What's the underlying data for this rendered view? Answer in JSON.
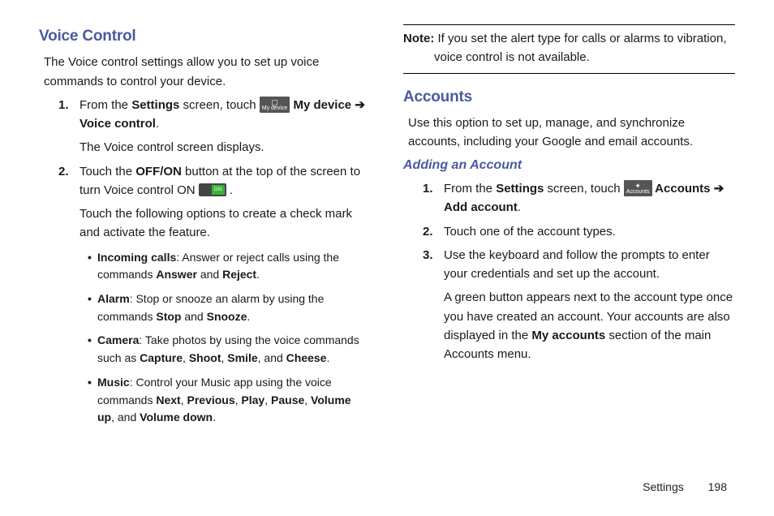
{
  "left": {
    "h_voice": "Voice Control",
    "voice_intro": "The Voice control settings allow you to set up voice commands to control your device.",
    "step1_a": "From the ",
    "step1_b": "Settings",
    "step1_c": " screen, touch ",
    "step1_icon": "My device",
    "step1_d": " My device ",
    "step1_arrow": "➔",
    "step1_e": "Voice control",
    "step1_dot": ".",
    "step1_extra": "The Voice control screen displays.",
    "step2_a": "Touch the ",
    "step2_b": "OFF/ON",
    "step2_c": " button at the top of the screen to turn Voice control ON ",
    "step2_toggle": "ON",
    "step2_d": " .",
    "step2_extra": "Touch the following options to create a check mark and activate the feature.",
    "feat_calls_a": "Incoming calls",
    "feat_calls_b": ": Answer or reject calls using the commands ",
    "feat_calls_c": "Answer",
    "feat_calls_d": " and ",
    "feat_calls_e": "Reject",
    "feat_calls_f": ".",
    "feat_alarm_a": "Alarm",
    "feat_alarm_b": ": Stop or snooze an alarm by using the commands ",
    "feat_alarm_c": "Stop",
    "feat_alarm_d": " and ",
    "feat_alarm_e": "Snooze",
    "feat_alarm_f": ".",
    "feat_cam_a": "Camera",
    "feat_cam_b": ": Take photos by using the voice commands such as ",
    "feat_cam_c": "Capture",
    "feat_cam_d": ", ",
    "feat_cam_e": "Shoot",
    "feat_cam_f": ", ",
    "feat_cam_g": "Smile",
    "feat_cam_h": ", and ",
    "feat_cam_i": "Cheese",
    "feat_cam_j": ".",
    "feat_music_a": "Music",
    "feat_music_b": ": Control your Music app using the voice commands ",
    "feat_music_c": "Next",
    "feat_music_d": ", ",
    "feat_music_e": "Previous",
    "feat_music_f": ", ",
    "feat_music_g": "Play",
    "feat_music_h": ", ",
    "feat_music_i": "Pause",
    "feat_music_j": ", ",
    "feat_music_k": "Volume up",
    "feat_music_l": ", and ",
    "feat_music_m": "Volume down",
    "feat_music_n": "."
  },
  "right": {
    "note_a": "Note:",
    "note_b": " If you set the alert type for calls or alarms to vibration, ",
    "note_c": "voice control is not available.",
    "h_accounts": "Accounts",
    "acc_intro": "Use this option to set up, manage, and synchronize accounts, including your Google and email accounts.",
    "h_add": "Adding an Account",
    "s1_a": "From the ",
    "s1_b": "Settings",
    "s1_c": " screen, touch ",
    "s1_icon": "Accounts",
    "s1_d": " Accounts ",
    "s1_arrow": "➔",
    "s1_e": " ",
    "s1_f": "Add account",
    "s1_g": ".",
    "s2": "Touch one of the account types.",
    "s3_a": "Use the keyboard and follow the prompts to enter your credentials and set up the account.",
    "s3_b_a": "A green button appears next to the account type once you have created an account. Your accounts are also displayed in the ",
    "s3_b_b": "My accounts",
    "s3_b_c": " section of the main Accounts menu."
  },
  "footer": {
    "label": "Settings",
    "page": "198"
  }
}
